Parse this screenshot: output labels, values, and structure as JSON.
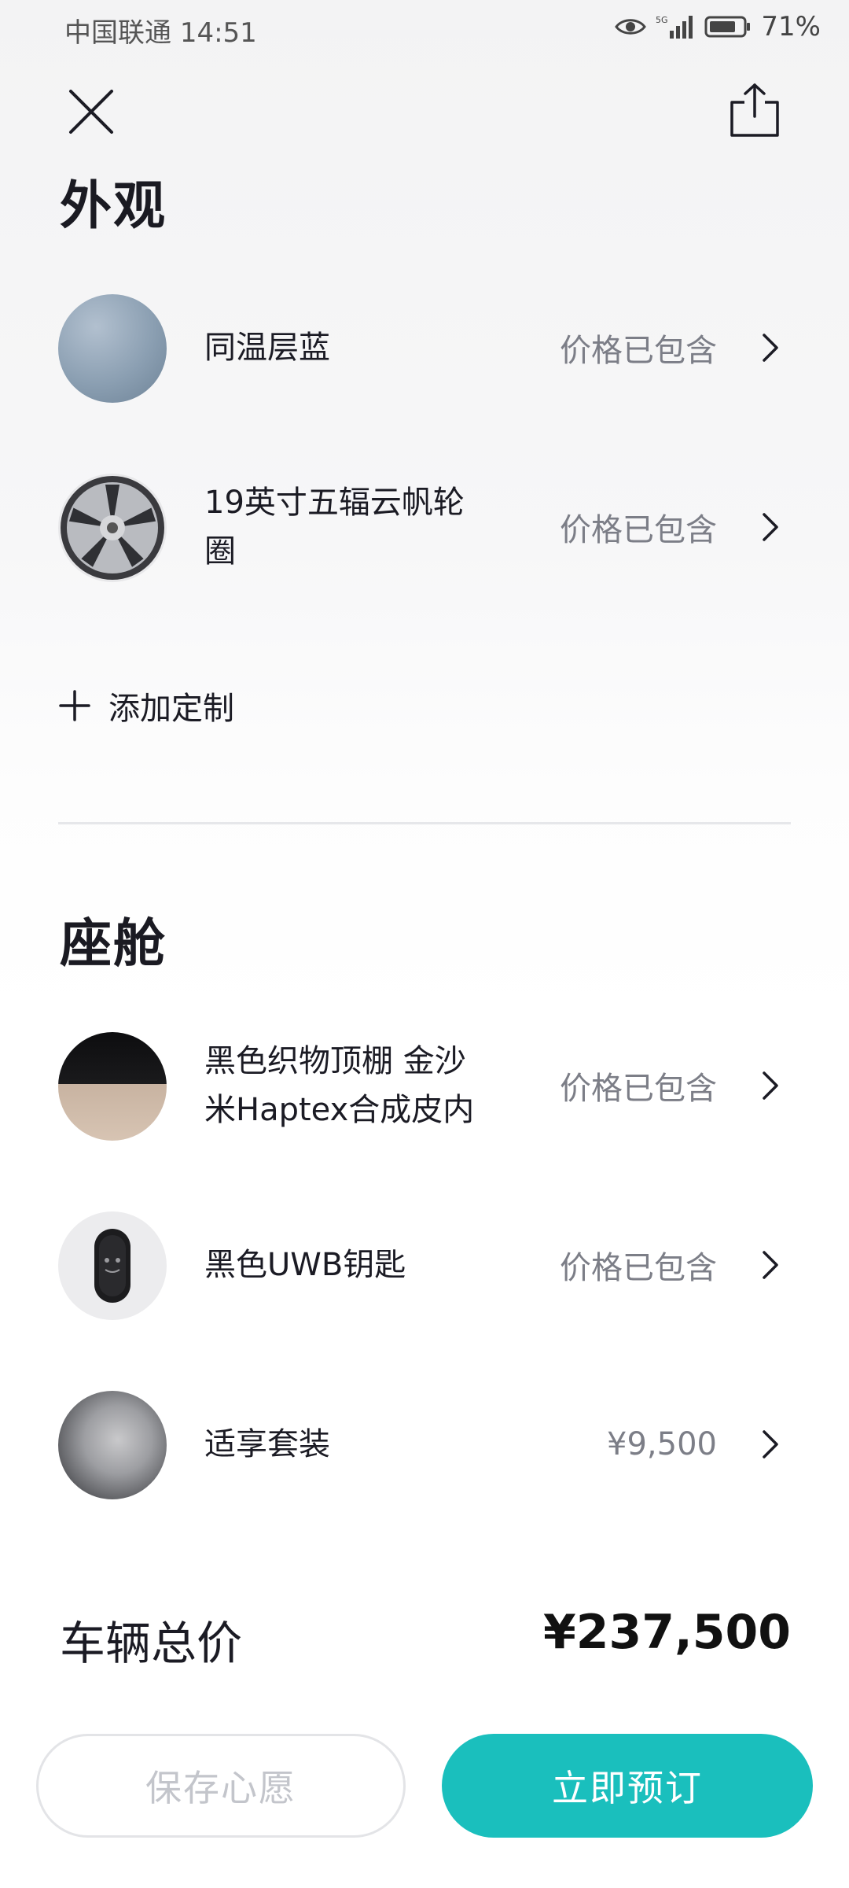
{
  "status_bar": {
    "carrier": "中国联通",
    "time": "14:51",
    "network": "5G",
    "battery": "71%"
  },
  "sections": {
    "exterior": {
      "title": "外观",
      "items": [
        {
          "name": "同温层蓝",
          "price": "价格已包含"
        },
        {
          "name": "19英寸五辐云帆轮圈",
          "price": "价格已包含"
        }
      ],
      "add_label": "添加定制"
    },
    "cabin": {
      "title": "座舱",
      "items": [
        {
          "name": "黑色织物顶棚 金沙米Haptex合成皮内",
          "price": "价格已包含"
        },
        {
          "name": "黑色UWB钥匙",
          "price": "价格已包含"
        },
        {
          "name": "适享套装",
          "price": "¥9,500"
        }
      ]
    }
  },
  "total": {
    "label": "车辆总价",
    "value": "¥237,500"
  },
  "actions": {
    "save_label": "保存心愿",
    "order_label": "立即预订"
  },
  "colors": {
    "accent": "#1abfbd",
    "muted_text": "#7c7e87"
  }
}
